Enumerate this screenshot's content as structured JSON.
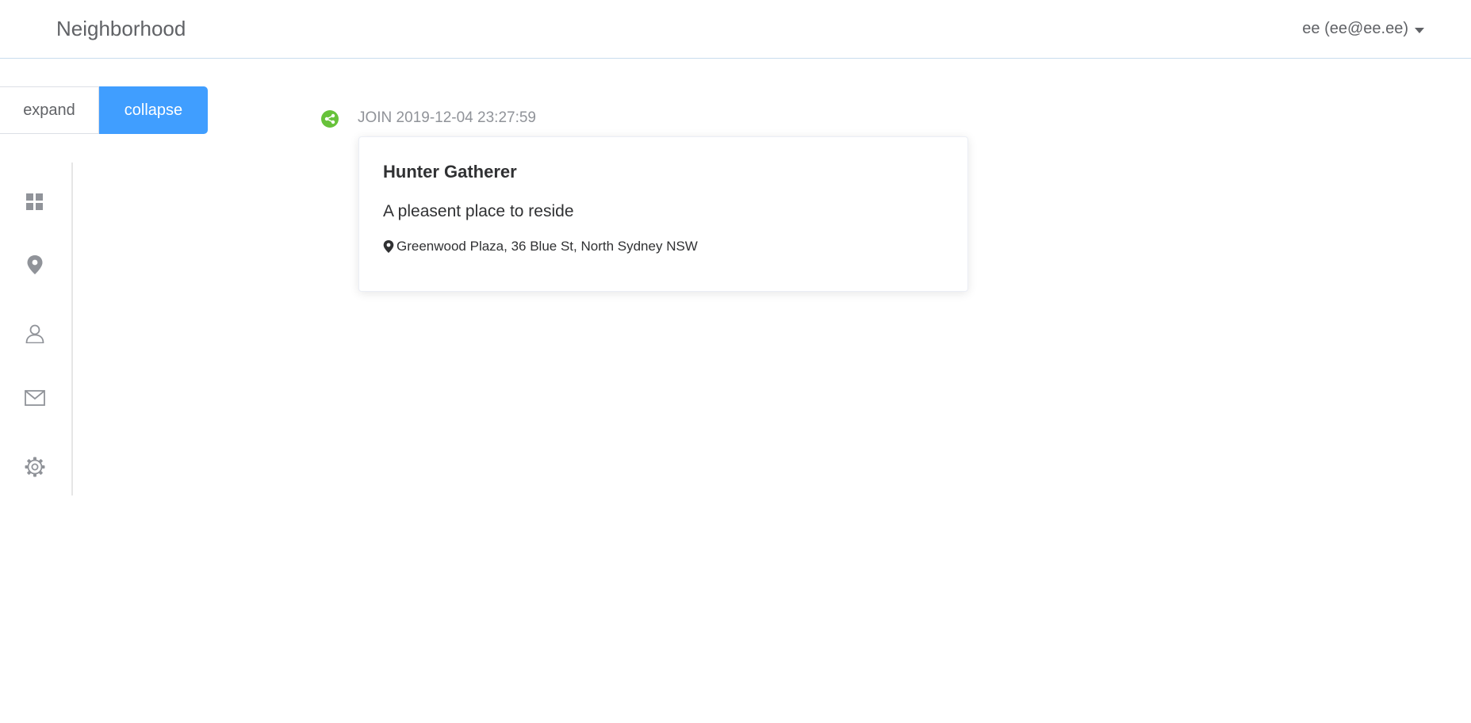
{
  "header": {
    "brand": "Neighborhood",
    "user_menu": "ee (ee@ee.ee)"
  },
  "toggle": {
    "expand_label": "expand",
    "collapse_label": "collapse",
    "active": "collapse",
    "active_color": "#409eff"
  },
  "sidebar": {
    "items": [
      {
        "icon": "dashboard-icon"
      },
      {
        "icon": "location-pin-icon"
      },
      {
        "icon": "user-icon"
      },
      {
        "icon": "mail-icon"
      },
      {
        "icon": "gear-icon"
      }
    ]
  },
  "timeline": {
    "event": {
      "timestamp": "JOIN 2019-12-04 23:27:59",
      "dot_icon": "share-icon",
      "dot_color": "#67c23a",
      "card": {
        "title": "Hunter Gatherer",
        "description": "A pleasent place to reside",
        "location": "Greenwood Plaza, 36 Blue St, North Sydney NSW"
      }
    }
  }
}
